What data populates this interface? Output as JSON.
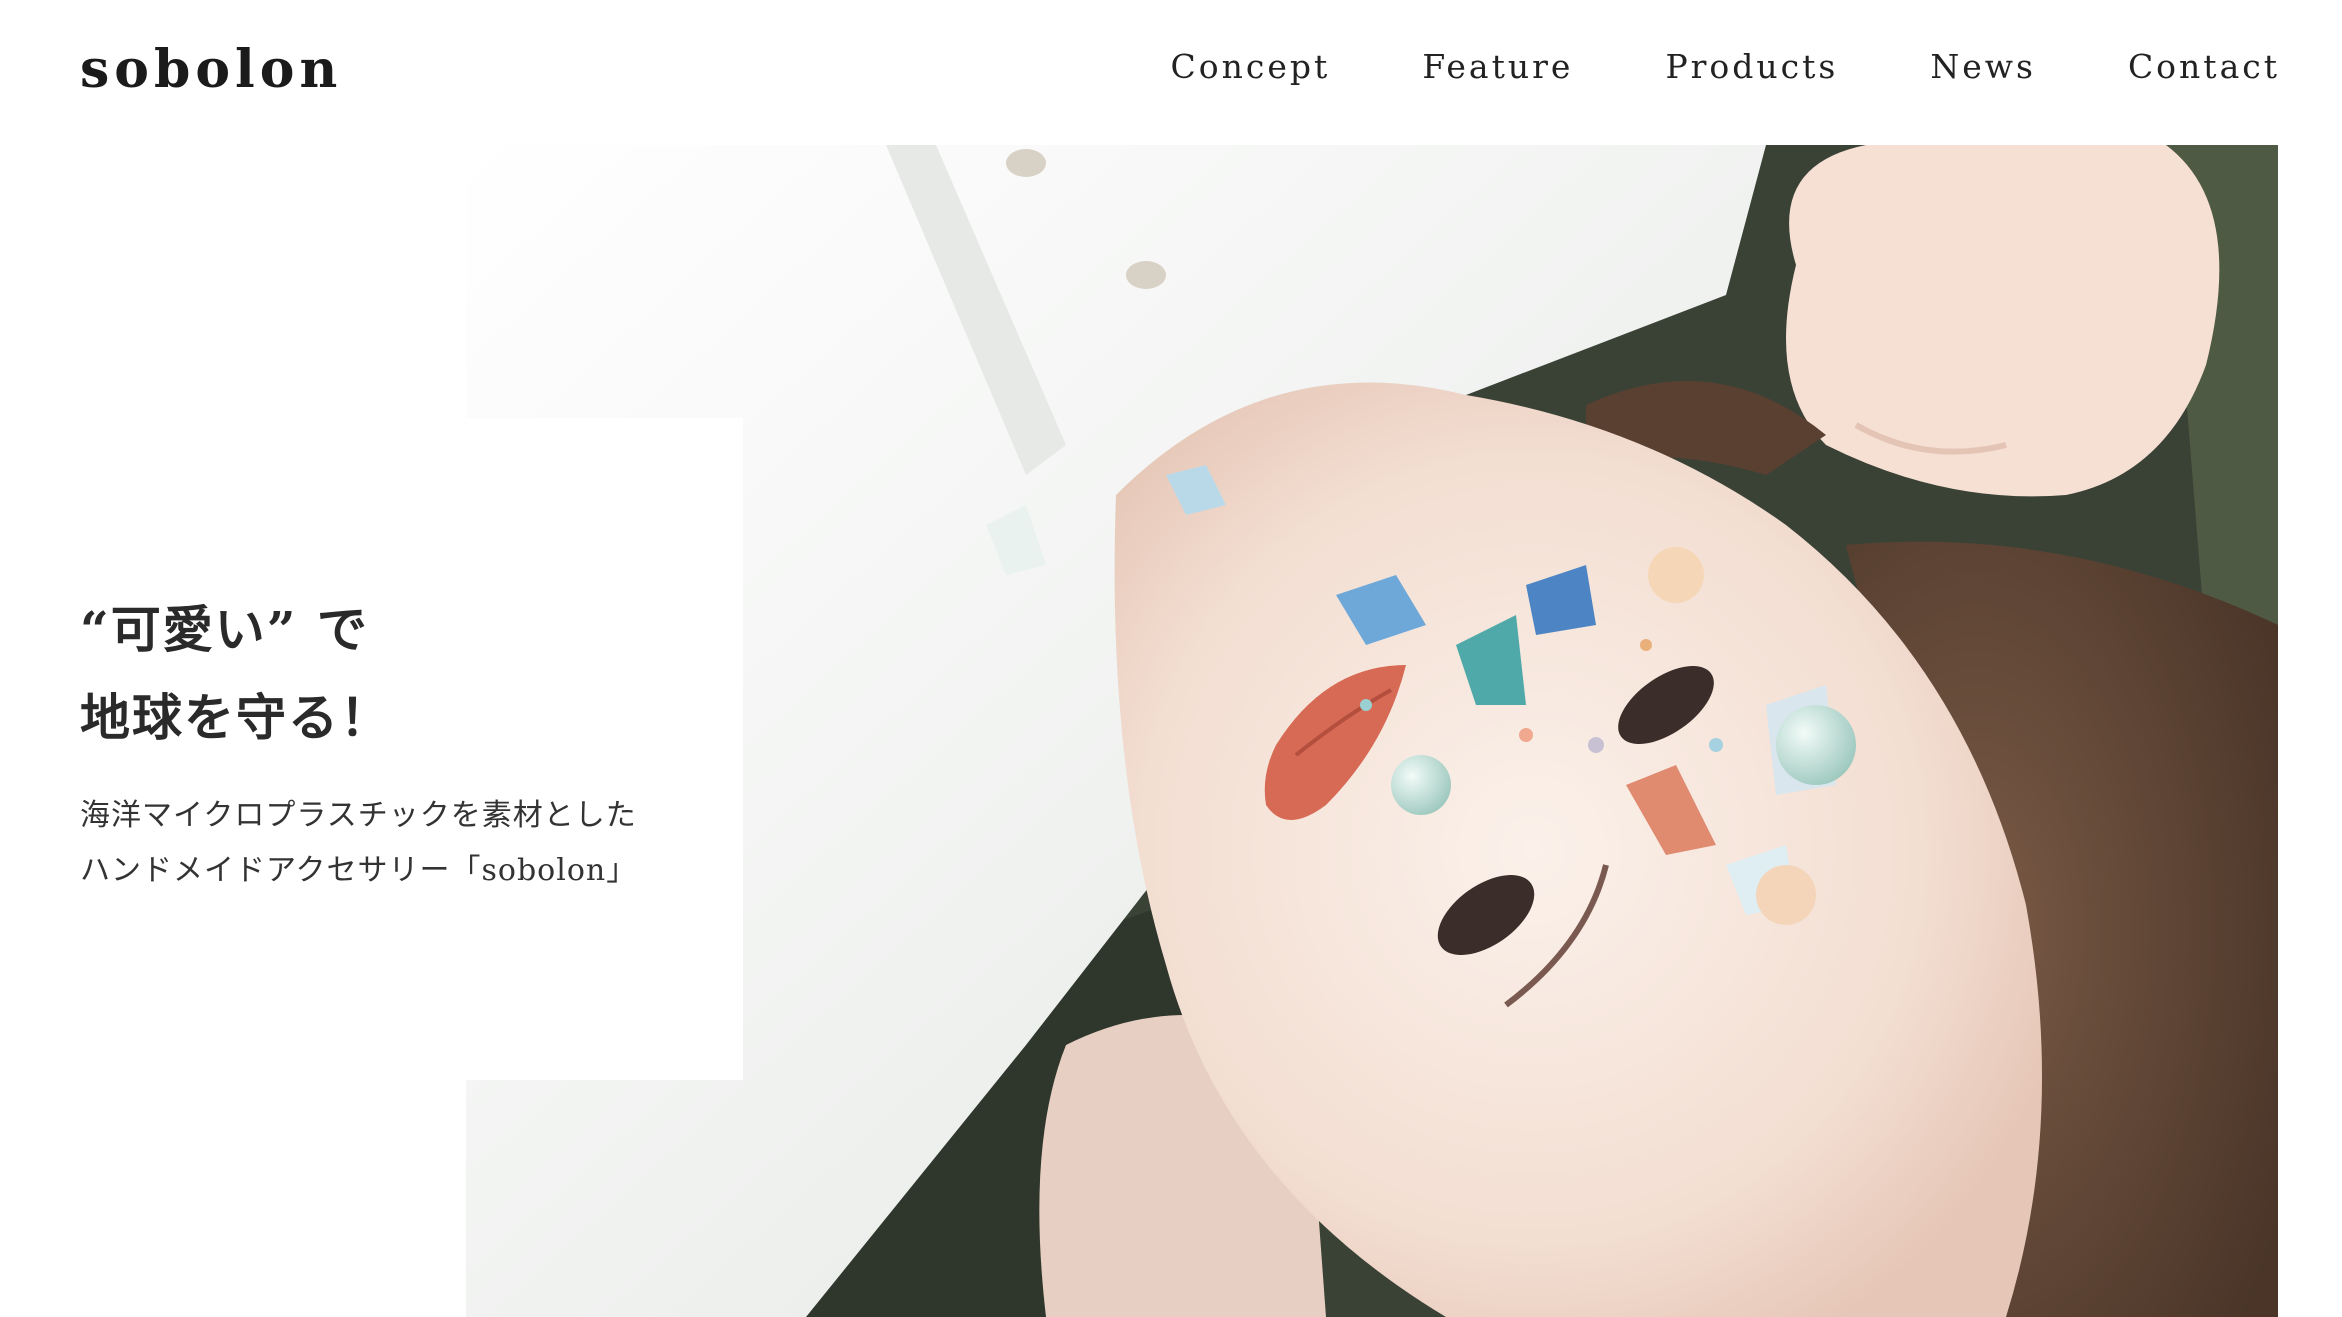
{
  "header": {
    "logo": "sobolon",
    "nav": [
      {
        "label": "Concept"
      },
      {
        "label": "Feature"
      },
      {
        "label": "Products"
      },
      {
        "label": "News"
      },
      {
        "label": "Contact"
      }
    ]
  },
  "hero": {
    "tagline_line1": "“可愛い” で",
    "tagline_line2": "地球を守る！",
    "description_line1": "海洋マイクロプラスチックを素材とした",
    "description_line2": "ハンドメイドアクセサリー「sobolon」"
  }
}
